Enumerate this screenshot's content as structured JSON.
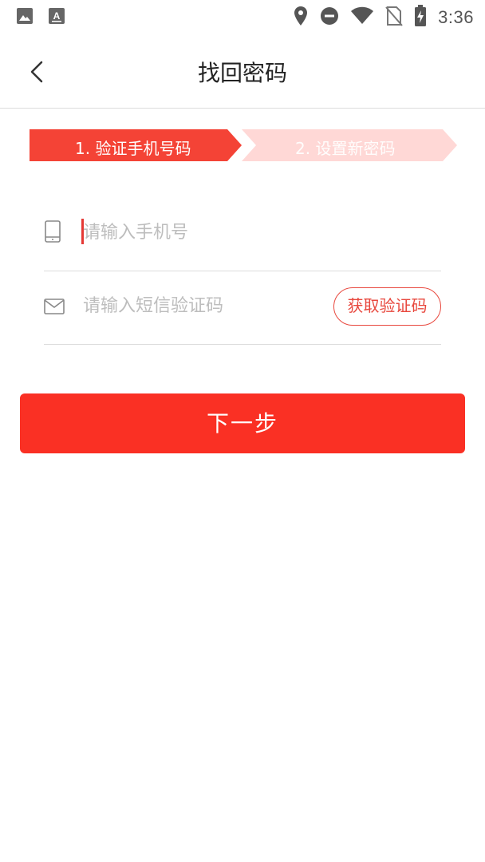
{
  "status_bar": {
    "time": "3:36",
    "left_icons": [
      "image-icon",
      "font-download-icon"
    ],
    "right_icons": [
      "location-icon",
      "do-not-disturb-icon",
      "wifi-icon",
      "no-sim-icon",
      "battery-charging-icon"
    ]
  },
  "header": {
    "title": "找回密码",
    "back_icon": "chevron-left-icon"
  },
  "steps": {
    "step1": "1. 验证手机号码",
    "step2": "2. 设置新密码",
    "active_color": "#f44336",
    "inactive_color": "#ffd8d6"
  },
  "form": {
    "phone": {
      "placeholder": "请输入手机号",
      "value": "",
      "icon": "phone-icon"
    },
    "sms_code": {
      "placeholder": "请输入短信验证码",
      "value": "",
      "icon": "mail-icon"
    },
    "get_code_label": "获取验证码"
  },
  "next_button": {
    "label": "下一步",
    "color": "#fa3024"
  }
}
